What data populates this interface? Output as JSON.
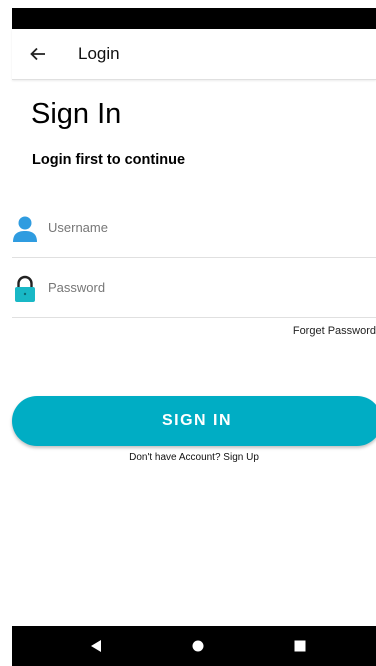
{
  "app_bar": {
    "title": "Login",
    "back_icon": "arrow-left-icon"
  },
  "main": {
    "heading": "Sign In",
    "subheading": "Login first to continue",
    "username": {
      "placeholder": "Username",
      "value": "",
      "icon": "user-icon"
    },
    "password": {
      "placeholder": "Password",
      "value": "",
      "icon": "lock-icon"
    },
    "forget_password": "Forget Password",
    "sign_in_button": "SIGN IN",
    "sign_up_text": "Don't have Account? Sign Up"
  },
  "colors": {
    "accent": "#00adc4",
    "icon_blue": "#2f9ce0",
    "lock_teal": "#19b8c6",
    "status_bar": "#000000"
  },
  "nav": {
    "back_icon": "triangle-back-icon",
    "home_icon": "circle-home-icon",
    "recents_icon": "square-recents-icon"
  }
}
